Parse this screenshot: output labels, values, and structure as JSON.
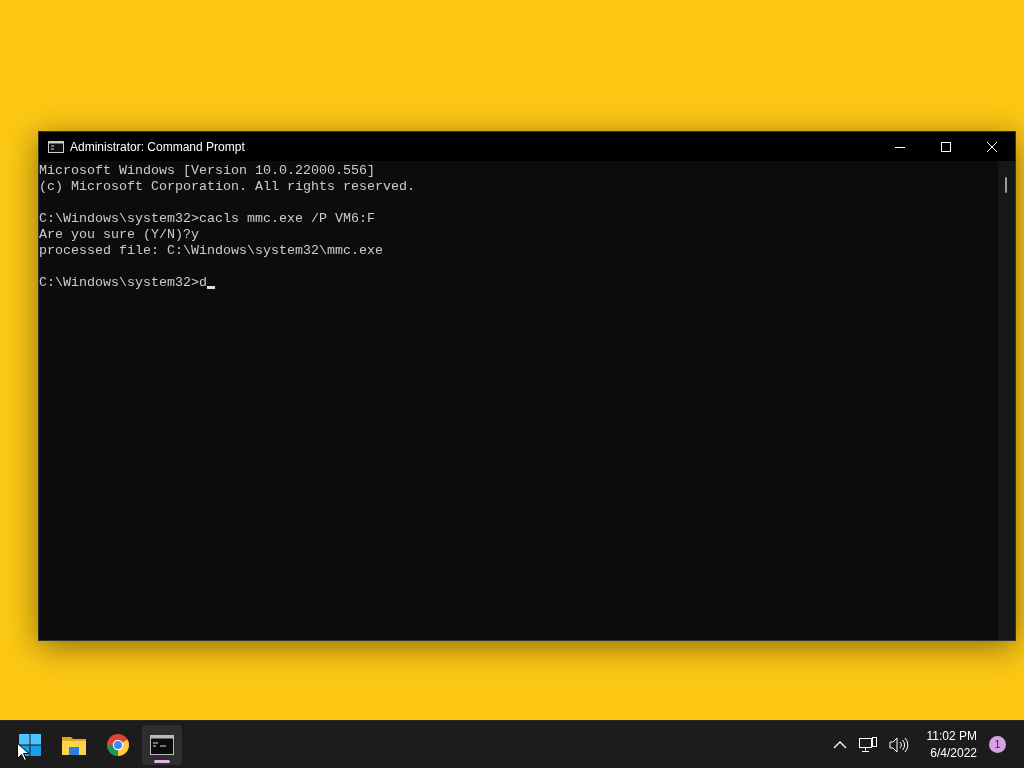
{
  "window": {
    "title": "Administrator: Command Prompt"
  },
  "console": {
    "blocks": [
      [
        "Microsoft Windows [Version 10.0.22000.556]",
        "(c) Microsoft Corporation. All rights reserved."
      ],
      [
        "C:\\Windows\\system32>cacls mmc.exe /P VM6:F",
        "Are you sure (Y/N)?y",
        "processed file: C:\\Windows\\system32\\mmc.exe"
      ],
      [
        "C:\\Windows\\system32>d"
      ]
    ],
    "cursor": true
  },
  "taskbar": {
    "apps": [
      {
        "kind": "start",
        "selected": false
      },
      {
        "kind": "folder",
        "selected": false
      },
      {
        "kind": "browser",
        "selected": false
      },
      {
        "kind": "terminal",
        "selected": true
      }
    ],
    "tray": {
      "time": "11:02 PM",
      "date": "6/4/2022",
      "notifications": "1"
    }
  }
}
